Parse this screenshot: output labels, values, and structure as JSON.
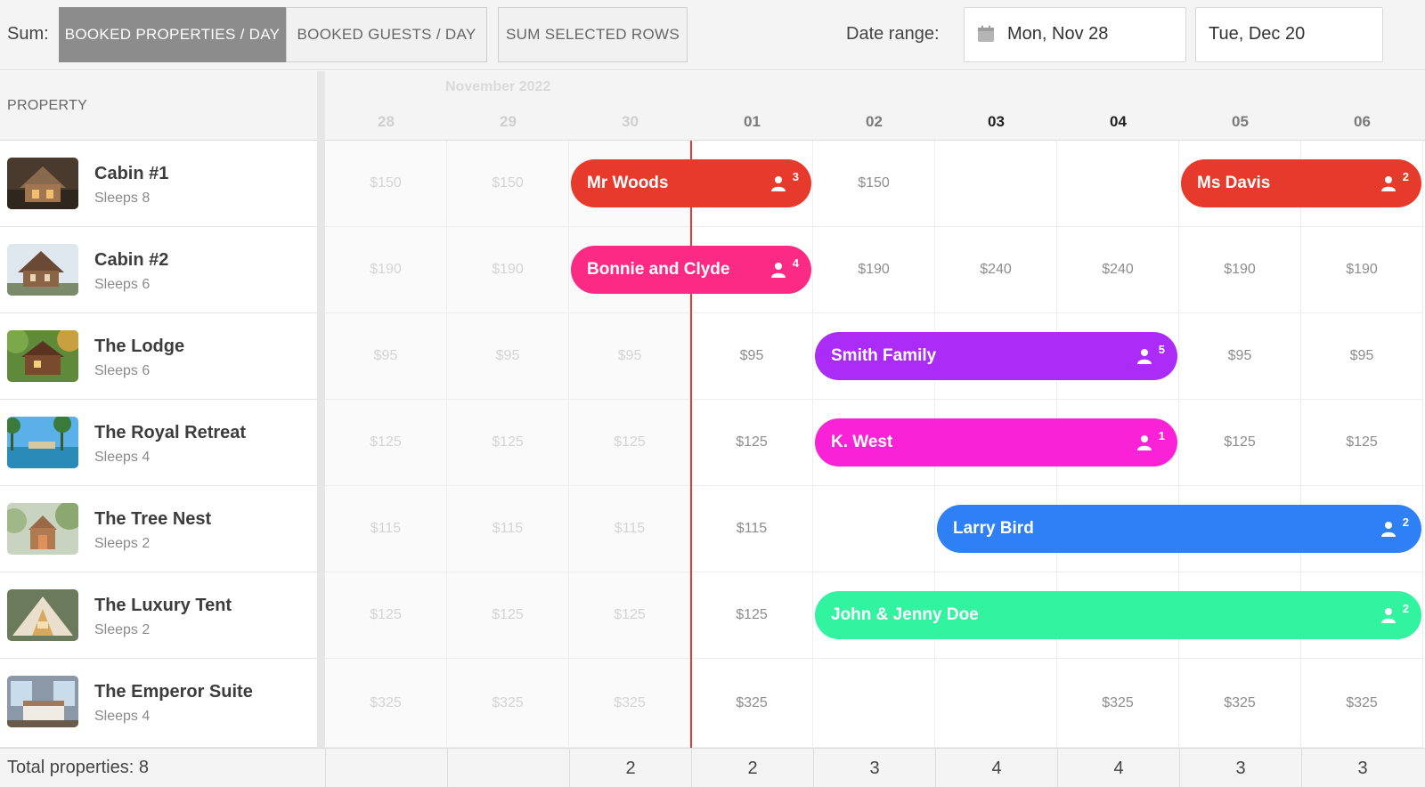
{
  "toolbar": {
    "sum_label": "Sum:",
    "buttons": [
      {
        "label": "BOOKED PROPERTIES / DAY",
        "active": true
      },
      {
        "label": "BOOKED GUESTS / DAY",
        "active": false
      },
      {
        "label": "SUM SELECTED ROWS",
        "active": false
      }
    ],
    "date_range_label": "Date range:",
    "date_start": "Mon, Nov 28",
    "date_end": "Tue, Dec 20",
    "calendar_icon": "calendar-icon"
  },
  "header": {
    "property_label": "PROPERTY",
    "month_label": "November 2022",
    "days": [
      {
        "label": "28",
        "style": "past"
      },
      {
        "label": "29",
        "style": "past"
      },
      {
        "label": "30",
        "style": "past"
      },
      {
        "label": "01",
        "style": "normal"
      },
      {
        "label": "02",
        "style": "normal"
      },
      {
        "label": "03",
        "style": "weekend"
      },
      {
        "label": "04",
        "style": "weekend"
      },
      {
        "label": "05",
        "style": "normal"
      },
      {
        "label": "06",
        "style": "normal"
      }
    ]
  },
  "properties": [
    {
      "name": "Cabin #1",
      "sleeps": "Sleeps 8"
    },
    {
      "name": "Cabin #2",
      "sleeps": "Sleeps 6"
    },
    {
      "name": "The Lodge",
      "sleeps": "Sleeps 6"
    },
    {
      "name": "The Royal Retreat",
      "sleeps": "Sleeps 4"
    },
    {
      "name": "The Tree Nest",
      "sleeps": "Sleeps 2"
    },
    {
      "name": "The Luxury Tent",
      "sleeps": "Sleeps 2"
    },
    {
      "name": "The Emperor Suite",
      "sleeps": "Sleeps 4"
    }
  ],
  "prices": [
    [
      "$150",
      "$150",
      "",
      "",
      "$150",
      "",
      "",
      "",
      ""
    ],
    [
      "$190",
      "$190",
      "",
      "",
      "$190",
      "$240",
      "$240",
      "$190",
      "$190"
    ],
    [
      "$95",
      "$95",
      "$95",
      "$95",
      "",
      "",
      "",
      "$95",
      "$95"
    ],
    [
      "$125",
      "$125",
      "$125",
      "$125",
      "",
      "",
      "",
      "$125",
      "$125"
    ],
    [
      "$115",
      "$115",
      "$115",
      "$115",
      "",
      "",
      "",
      "",
      ""
    ],
    [
      "$125",
      "$125",
      "$125",
      "$125",
      "",
      "",
      "",
      "",
      ""
    ],
    [
      "$325",
      "$325",
      "$325",
      "$325",
      "",
      "",
      "$325",
      "$325",
      "$325"
    ]
  ],
  "blocked": [
    [
      0,
      5
    ],
    [
      0,
      6
    ],
    [
      4,
      4
    ],
    [
      6,
      4
    ],
    [
      6,
      5
    ]
  ],
  "bookings": [
    {
      "guest": "Mr Woods",
      "guests": "3",
      "row": 0,
      "start": 2,
      "days": 2,
      "color": "#e53a2c"
    },
    {
      "guest": "Ms Davis",
      "guests": "2",
      "row": 0,
      "start": 7,
      "days": 2,
      "color": "#e53a2c"
    },
    {
      "guest": "Bonnie and Clyde",
      "guests": "4",
      "row": 1,
      "start": 2,
      "days": 2,
      "color": "#fb2a84"
    },
    {
      "guest": "Smith Family",
      "guests": "5",
      "row": 2,
      "start": 4,
      "days": 3,
      "color": "#aa2cf6"
    },
    {
      "guest": "K. West",
      "guests": "1",
      "row": 3,
      "start": 4,
      "days": 3,
      "color": "#f922d6"
    },
    {
      "guest": "Larry Bird",
      "guests": "2",
      "row": 4,
      "start": 5,
      "days": 4,
      "color": "#2f7ff5"
    },
    {
      "guest": "John & Jenny Doe",
      "guests": "2",
      "row": 5,
      "start": 4,
      "days": 5,
      "color": "#32f3a0"
    }
  ],
  "footer": {
    "label": "Total properties: 8",
    "totals": [
      "",
      "",
      "2",
      "2",
      "3",
      "4",
      "4",
      "3",
      "3"
    ]
  }
}
